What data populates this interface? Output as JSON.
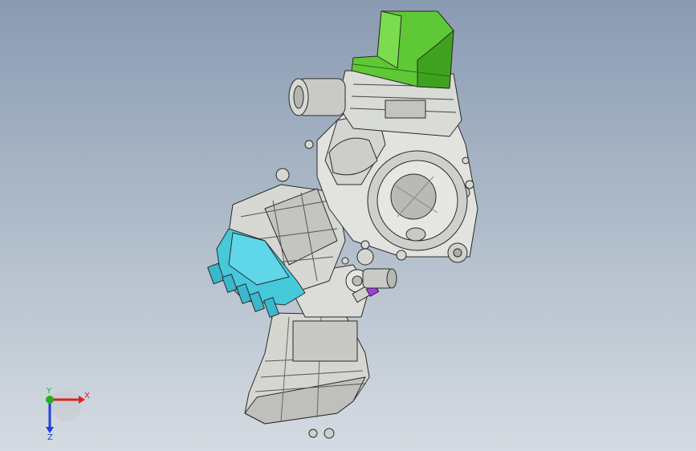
{
  "viewport": {
    "background_top": "#8a9bb2",
    "background_bottom": "#d5dbe2"
  },
  "model": {
    "parts": [
      {
        "name": "cylinder-head-cover",
        "color": "#5ec836"
      },
      {
        "name": "cylinder-block",
        "color": "#d9dbd6"
      },
      {
        "name": "crankcase",
        "color": "#e2e3df"
      },
      {
        "name": "flywheel-cover",
        "color": "#cfd0cc"
      },
      {
        "name": "intake-manifold",
        "color": "#d7d8d3"
      },
      {
        "name": "throttle-body",
        "color": "#47c9dc"
      },
      {
        "name": "oil-sump",
        "color": "#d6d6d1"
      },
      {
        "name": "starter-motor",
        "color": "#c9cac6"
      },
      {
        "name": "sensor-connector",
        "color": "#a23ce0"
      }
    ]
  },
  "triad": {
    "x_label": "X",
    "y_label": "Y",
    "z_label": "Z",
    "x_color": "#e02020",
    "y_color": "#22b022",
    "z_color": "#2040d8"
  }
}
